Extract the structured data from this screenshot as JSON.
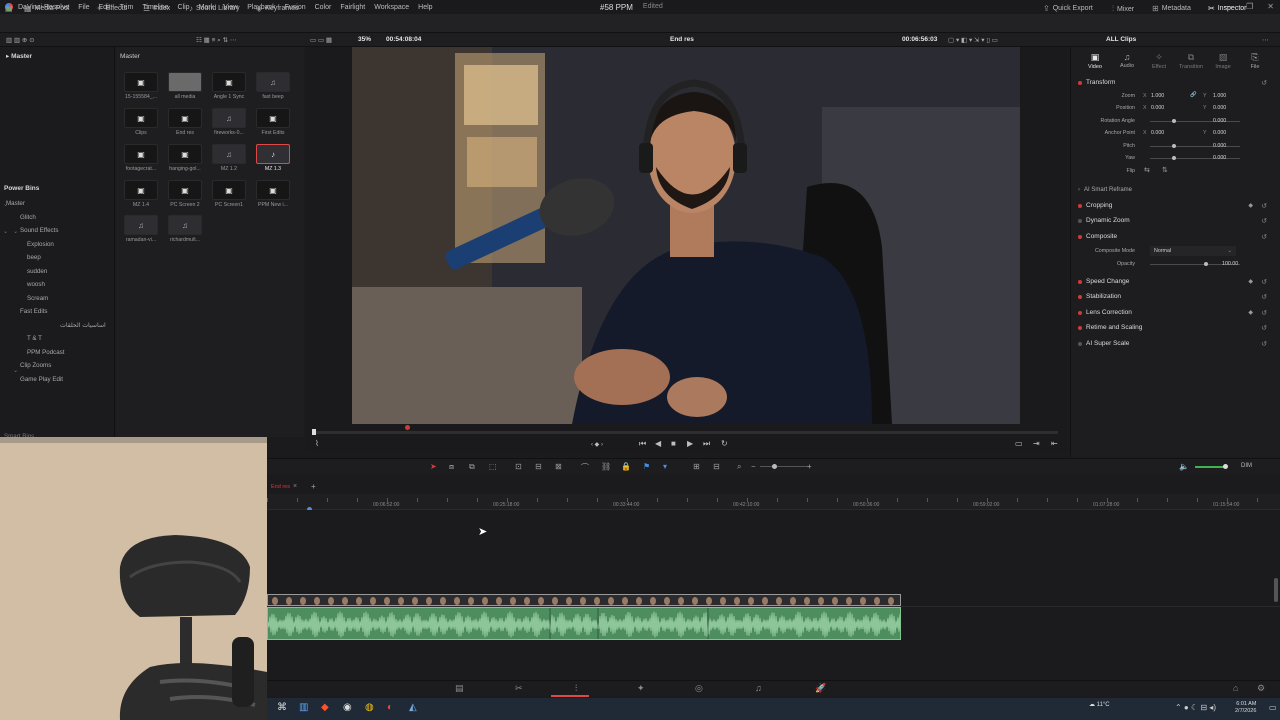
{
  "menubar": {
    "app": "DaVinci Resolve",
    "items": [
      "File",
      "Edit",
      "Trim",
      "Timeline",
      "Clip",
      "Mark",
      "View",
      "Playback",
      "Fusion",
      "Color",
      "Fairlight",
      "Workspace",
      "Help"
    ]
  },
  "toolbar": {
    "media_pool": "Media Pool",
    "effects": "Effects",
    "index": "Index",
    "sound_library": "Sound Library",
    "keyframes": "Keyframes",
    "project_title": "#58 PPM",
    "edited": "Edited",
    "quick_export": "Quick Export",
    "mixer": "Mixer",
    "metadata": "Metadata",
    "inspector": "Inspector"
  },
  "subbar": {
    "zoom": "35%",
    "source_tc": "00:54:08:04",
    "timeline_name": "End res",
    "record_tc": "00:06:56:03",
    "all_clips": "ALL Clips"
  },
  "bins": {
    "root": "Master",
    "power_bins_title": "Power Bins",
    "power_items": [
      {
        "label": "Master",
        "level": 0
      },
      {
        "label": "Glitch",
        "level": 1
      },
      {
        "label": "Sound Effects",
        "level": 1
      },
      {
        "label": "Explosion",
        "level": 2
      },
      {
        "label": "beep",
        "level": 2
      },
      {
        "label": "sudden",
        "level": 2
      },
      {
        "label": "woosh",
        "level": 2
      },
      {
        "label": "Scream",
        "level": 2
      },
      {
        "label": "Fast Edits",
        "level": 1
      },
      {
        "label": "اساسيات الحلقات",
        "level": 1
      },
      {
        "label": "T & T",
        "level": 2
      },
      {
        "label": "PPM Podcast",
        "level": 2
      },
      {
        "label": "Clip Zooms",
        "level": 1
      },
      {
        "label": "Game Play Edit",
        "level": 1
      }
    ],
    "smart_bins": "Smart Bins"
  },
  "pool": {
    "title": "Master",
    "clips": [
      {
        "label": "15-155584_...",
        "kind": "film"
      },
      {
        "label": "all media",
        "kind": "grey"
      },
      {
        "label": "Angle 1 Sync",
        "kind": "film"
      },
      {
        "label": "fast beep",
        "kind": "audio"
      },
      {
        "label": "Clips",
        "kind": "film"
      },
      {
        "label": "End res",
        "kind": "film"
      },
      {
        "label": "fireworks-0...",
        "kind": "audio"
      },
      {
        "label": "First Edits",
        "kind": "film"
      },
      {
        "label": "footagecrat...",
        "kind": "film"
      },
      {
        "label": "hanging-gol...",
        "kind": "film"
      },
      {
        "label": "MZ 1.2",
        "kind": "audio"
      },
      {
        "label": "MZ 1.3",
        "kind": "sel"
      },
      {
        "label": "MZ 1.4",
        "kind": "film"
      },
      {
        "label": "PC Screen 2",
        "kind": "film"
      },
      {
        "label": "PC Screen1",
        "kind": "film"
      },
      {
        "label": "PPM New i...",
        "kind": "film"
      },
      {
        "label": "ramadan-vi...",
        "kind": "audio"
      },
      {
        "label": "richardmult...",
        "kind": "audio"
      }
    ]
  },
  "inspector": {
    "tabs": [
      "Video",
      "Audio",
      "Effect",
      "Transition",
      "Image",
      "File"
    ],
    "transform_title": "Transform",
    "zoom_label": "Zoom",
    "zoom_x": "1.000",
    "zoom_y": "1.000",
    "position_label": "Position",
    "position_x": "0.000",
    "position_y": "0.000",
    "rotation_label": "Rotation Angle",
    "rotation_value": "0.000",
    "anchor_label": "Anchor Point",
    "anchor_x": "0.000",
    "anchor_y": "0.000",
    "pitch_label": "Pitch",
    "pitch_value": "0.000",
    "yaw_label": "Yaw",
    "yaw_value": "0.000",
    "flip_label": "Flip",
    "ai_reframe": "AI Smart Reframe",
    "cropping": "Cropping",
    "dynamic_zoom": "Dynamic Zoom",
    "composite": "Composite",
    "composite_mode_label": "Composite Mode",
    "composite_mode": "Normal",
    "opacity_label": "Opacity",
    "opacity": "100.00",
    "speed_change": "Speed Change",
    "stabilization": "Stabilization",
    "lens_correction": "Lens Correction",
    "retime_scaling": "Retime and Scaling",
    "super_scale": "AI Super Scale"
  },
  "timeline": {
    "tab_label": "End res",
    "timecodes": [
      "00:06:52:00",
      "00:25:18:00",
      "00:33:44:00",
      "00:42:10:00",
      "00:50:36:00",
      "00:59:02:00",
      "01:07:28:00",
      "01:15:54:00"
    ],
    "dim_label": "DIM"
  },
  "taskbar": {
    "weather": "11°C",
    "time": "6:01 AM",
    "date": "2/7/2026"
  },
  "colors": {
    "accent_red": "#d23a3a",
    "audio_green": "#4e8e5e",
    "active_page": "#e04848"
  }
}
